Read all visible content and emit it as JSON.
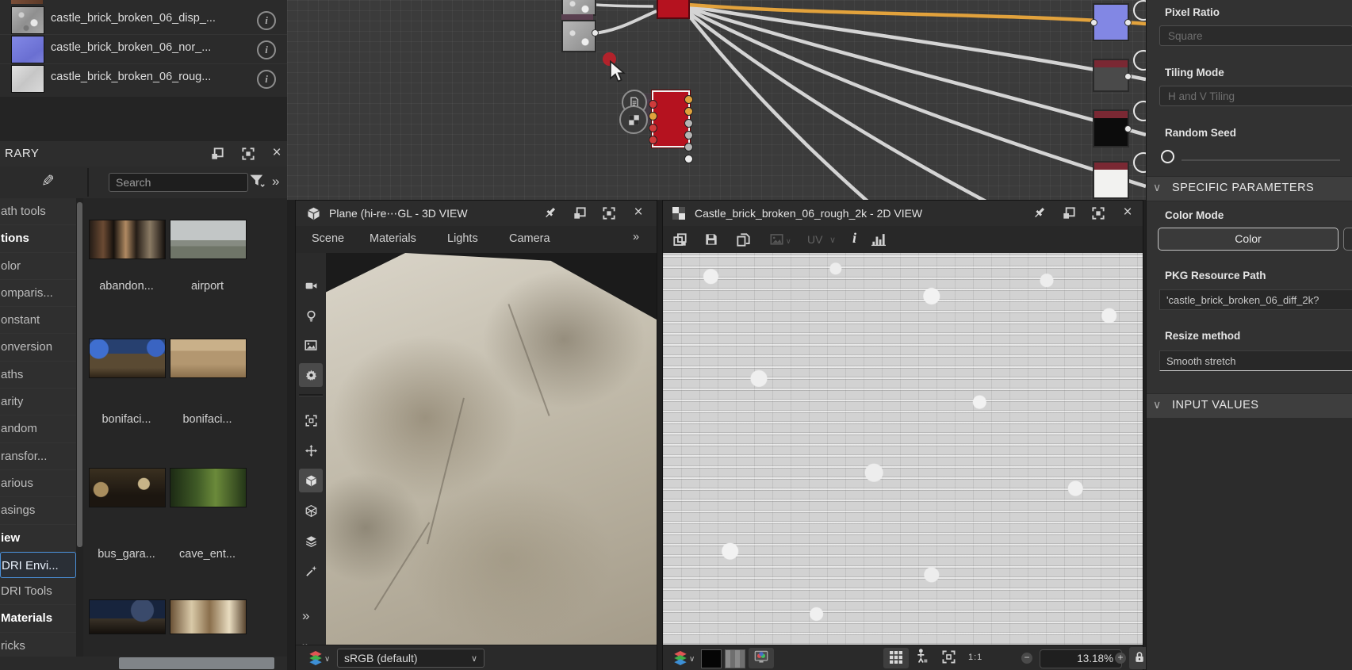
{
  "colors": {
    "accent": "#4a90d9",
    "node_red": "#b5121f",
    "wire_orange": "#e2a23c",
    "normal_map_blue": "#7b80da"
  },
  "glyphs": {
    "chevrons": "»",
    "close": "×",
    "pencil": "✎",
    "caret": "∨",
    "minus": "−",
    "plus": "+",
    "info": "i"
  },
  "files": {
    "items": [
      "castle_brick_broken_06_disp_...",
      "castle_brick_broken_06_nor_...",
      "castle_brick_broken_06_roug..."
    ]
  },
  "library": {
    "title": "RARY",
    "search_placeholder": "Search",
    "categories": [
      "ath tools",
      "tions",
      "olor",
      "omparis...",
      "onstant",
      "onversion",
      "aths",
      "arity",
      "andom",
      "ransfor...",
      "arious",
      "asings",
      "iew",
      "DRI Envi...",
      "DRI Tools",
      "Materials",
      "ricks"
    ],
    "thumb_labels": [
      "abandon...",
      "airport",
      "bonifaci...",
      "bonifaci...",
      "bus_gara...",
      "cave_ent..."
    ]
  },
  "view3d": {
    "title": "Plane (hi-re⋯GL -  3D VIEW",
    "menus": [
      "Scene",
      "Materials",
      "Lights",
      "Camera"
    ],
    "colorspace": "sRGB (default)"
  },
  "view2d": {
    "title": "Castle_brick_broken_06_rough_2k -  2D VIEW",
    "uv_label": "UV",
    "zoom_level": "13.18%",
    "one_to_one": "1:1"
  },
  "properties": {
    "pixel_ratio_label": "Pixel Ratio",
    "pixel_ratio_value": "Square",
    "tiling_mode_label": "Tiling Mode",
    "tiling_mode_value": "H and V Tiling",
    "random_seed_label": "Random Seed",
    "specific_parameters_header": "SPECIFIC PARAMETERS",
    "color_mode_label": "Color Mode",
    "color_mode_value": "Color",
    "pkg_path_label": "PKG Resource Path",
    "pkg_path_value": "'castle_brick_broken_06_diff_2k?",
    "resize_method_label": "Resize method",
    "resize_method_value": "Smooth stretch",
    "input_values_header": "INPUT VALUES"
  }
}
